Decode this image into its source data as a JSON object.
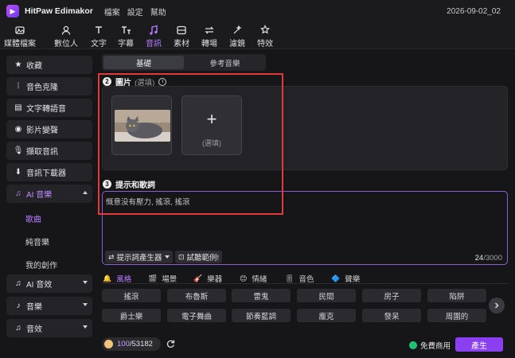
{
  "titlebar": {
    "app_title": "HitPaw Edimakor",
    "menus": [
      "檔案",
      "設定",
      "幫助"
    ],
    "project_name": "2026-09-02_02"
  },
  "toolbar": {
    "tools": [
      {
        "label": "媒體檔案",
        "icon": "media-icon"
      },
      {
        "label": "數位人",
        "icon": "avatar-icon"
      },
      {
        "label": "文字",
        "icon": "text-icon"
      },
      {
        "label": "字幕",
        "icon": "subtitle-icon"
      },
      {
        "label": "音訊",
        "icon": "audio-icon",
        "active": true
      },
      {
        "label": "素材",
        "icon": "materials-icon"
      },
      {
        "label": "轉場",
        "icon": "transition-icon"
      },
      {
        "label": "濾鏡",
        "icon": "filter-icon"
      },
      {
        "label": "特效",
        "icon": "effects-icon"
      }
    ]
  },
  "sidebar": {
    "items": [
      {
        "label": "收藏",
        "icon": "star-icon"
      },
      {
        "label": "音色克隆",
        "icon": "voice-clone-icon"
      },
      {
        "label": "文字轉語音",
        "icon": "text-to-speech-icon"
      },
      {
        "label": "影片變聲",
        "icon": "voice-changer-icon"
      },
      {
        "label": "擷取音訊",
        "icon": "microphone-icon"
      },
      {
        "label": "音訊下載器",
        "icon": "download-icon"
      },
      {
        "label": "AI 音樂",
        "icon": "ai-music-icon"
      },
      {
        "label": "AI 音效",
        "icon": "ai-sound-effect-icon"
      },
      {
        "label": "音樂",
        "icon": "music-note-icon"
      },
      {
        "label": "音效",
        "icon": "sound-effect-icon"
      }
    ],
    "ai_music_subitems": [
      "歌曲",
      "純音樂",
      "我的創作"
    ]
  },
  "main": {
    "tabs": [
      "基礎",
      "參考音樂"
    ],
    "image_section": {
      "number": "2",
      "title": "圖片",
      "optional": "(選填)",
      "add_optional": "(選填)",
      "add_symbol": "+"
    },
    "prompt_section": {
      "number": "3",
      "title": "提示和歌詞",
      "text": "慨意没有壓力, 搖滾, 搖滾",
      "generator_button": "提示詞產生器",
      "example_button": "試聽範例!",
      "count_used": "24",
      "count_max": "/3000"
    },
    "categories": [
      {
        "label": "風格",
        "icon": "style-icon",
        "active": true
      },
      {
        "label": "場景",
        "icon": "scene-icon"
      },
      {
        "label": "樂器",
        "icon": "instrument-icon"
      },
      {
        "label": "情緒",
        "icon": "mood-icon"
      },
      {
        "label": "音色",
        "icon": "timbre-icon"
      },
      {
        "label": "聲樂",
        "icon": "vocal-icon"
      }
    ],
    "style_chips": [
      "搖滾",
      "布魯斯",
      "雷鬼",
      "民間",
      "房子",
      "陷阱",
      "爵士樂",
      "電子舞曲",
      "節奏藍調",
      "龐克",
      "發呆",
      "周圍的"
    ]
  },
  "footer": {
    "credits_used": "100",
    "credits_total": "/53182",
    "free_commercial": "免費商用",
    "generate": "產生"
  },
  "colors": {
    "accent": "#8a3ff0",
    "highlight_box": "#e23a3a",
    "prompt_border": "#8b5ed6"
  }
}
